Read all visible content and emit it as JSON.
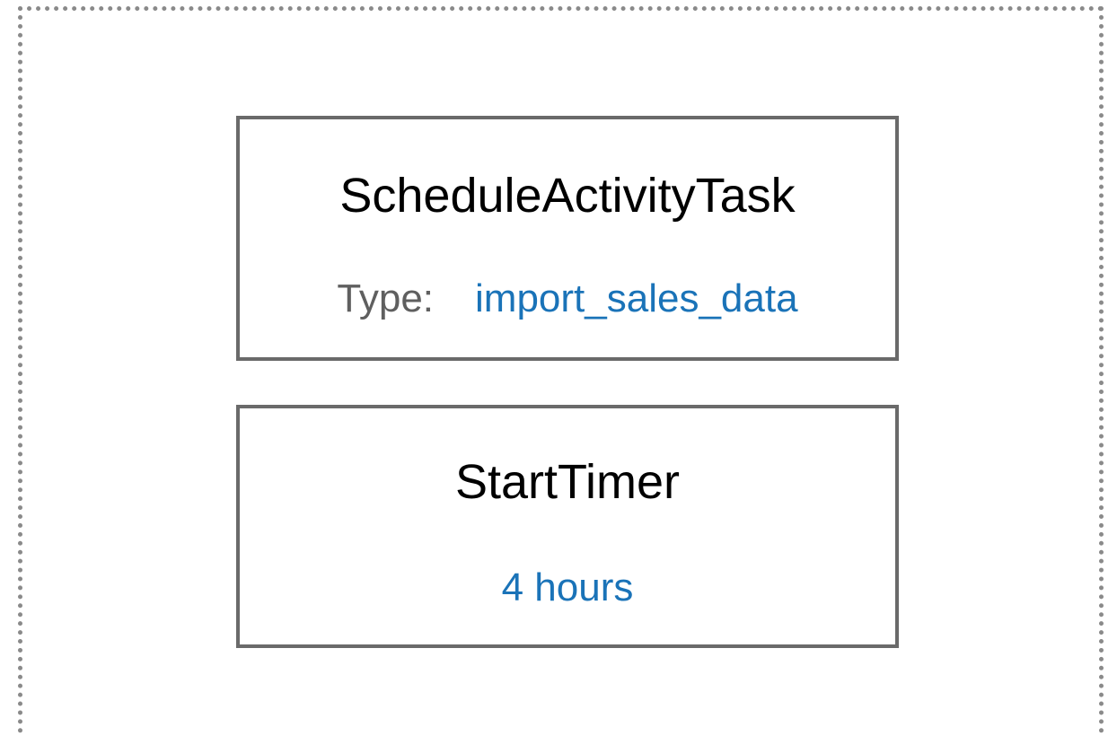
{
  "nodes": [
    {
      "title": "ScheduleActivityTask",
      "label": "Type:",
      "value": "import_sales_data"
    },
    {
      "title": "StartTimer",
      "value": "4 hours"
    }
  ],
  "colors": {
    "value_text": "#1a73b8",
    "label_text": "#5f5f5f",
    "box_border": "#6a6a6a",
    "frame_border": "#8a8a8a"
  }
}
